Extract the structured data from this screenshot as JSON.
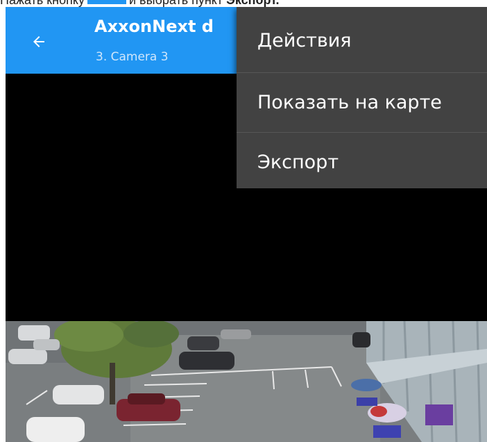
{
  "instruction": {
    "prefix": "Нажать кнопку",
    "middle": "и выбрать пункт",
    "bold": "Экспорт."
  },
  "appbar": {
    "title": "AxxonNext d",
    "subtitle": "3. Camera 3",
    "back_icon": "arrow-left-icon"
  },
  "menu": {
    "items": [
      {
        "label": "Действия"
      },
      {
        "label": "Показать на карте"
      },
      {
        "label": "Экспорт"
      }
    ]
  },
  "colors": {
    "appbar": "#2196f3",
    "menu_bg": "#424242",
    "video_bg": "#000000"
  }
}
